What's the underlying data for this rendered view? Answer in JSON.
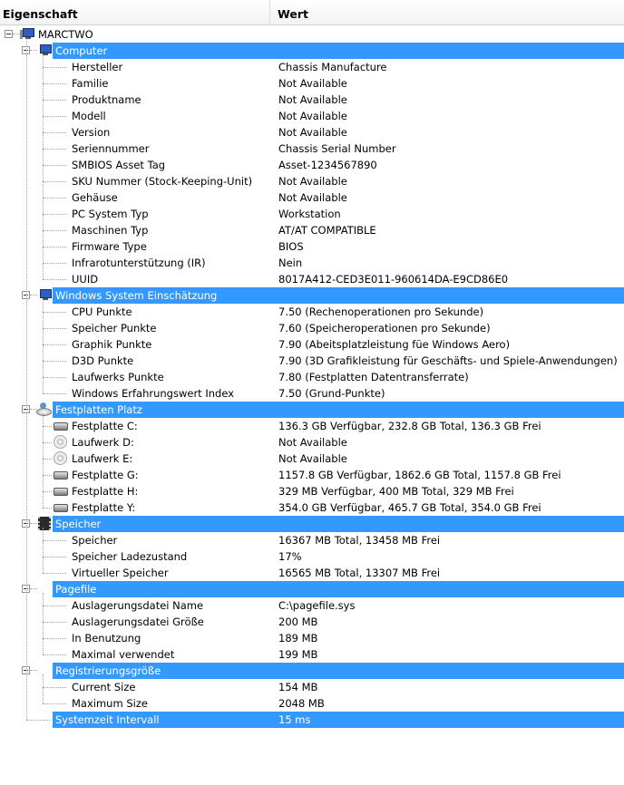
{
  "columns": {
    "property": "Eigenschaft",
    "value": "Wert"
  },
  "root": {
    "label": "MARCTWO",
    "icon": "computer-icon"
  },
  "groups": [
    {
      "id": "computer",
      "label": "Computer",
      "icon": "computer-icon",
      "items": [
        {
          "label": "Hersteller",
          "value": "Chassis Manufacture"
        },
        {
          "label": "Familie",
          "value": "Not Available"
        },
        {
          "label": "Produktname",
          "value": "Not Available"
        },
        {
          "label": "Modell",
          "value": "Not Available"
        },
        {
          "label": "Version",
          "value": "Not Available"
        },
        {
          "label": "Seriennummer",
          "value": "Chassis Serial Number"
        },
        {
          "label": "SMBIOS Asset Tag",
          "value": "Asset-1234567890"
        },
        {
          "label": "SKU Nummer (Stock-Keeping-Unit)",
          "value": "Not Available"
        },
        {
          "label": "Gehäuse",
          "value": "Not Available"
        },
        {
          "label": "PC System Typ",
          "value": "Workstation"
        },
        {
          "label": "Maschinen Typ",
          "value": "AT/AT COMPATIBLE"
        },
        {
          "label": "Firmware Type",
          "value": "BIOS"
        },
        {
          "label": "Infrarotunterstützung (IR)",
          "value": "Nein"
        },
        {
          "label": "UUID",
          "value": "8017A412-CED3E011-960614DA-E9CD86E0"
        }
      ]
    },
    {
      "id": "wsa",
      "label": "Windows System Einschätzung",
      "icon": "monitor-icon",
      "items": [
        {
          "label": "CPU Punkte",
          "value": "7.50 (Rechenoperationen pro Sekunde)"
        },
        {
          "label": "Speicher Punkte",
          "value": "7.60 (Speicheroperationen pro Sekunde)"
        },
        {
          "label": "Graphik Punkte",
          "value": "7.90 (Abeitsplatzleistung füe Windows Aero)"
        },
        {
          "label": "D3D Punkte",
          "value": "7.90 (3D Grafikleistung für Geschäfts- und Spiele-Anwendungen)"
        },
        {
          "label": "Laufwerks Punkte",
          "value": "7.80 (Festplatten Datentransferrate)"
        },
        {
          "label": "Windows Erfahrungswert Index",
          "value": "7.50 (Grund-Punkte)"
        }
      ]
    },
    {
      "id": "disk",
      "label": "Festplatten Platz",
      "icon": "disk-user-icon",
      "items": [
        {
          "label": "Festplatte C:",
          "value": "136.3 GB Verfügbar, 232.8 GB Total, 136.3 GB Frei",
          "icon": "hard-drive-icon"
        },
        {
          "label": "Laufwerk D:",
          "value": "Not Available",
          "icon": "cd-drive-icon"
        },
        {
          "label": "Laufwerk E:",
          "value": "Not Available",
          "icon": "cd-drive-icon"
        },
        {
          "label": "Festplatte G:",
          "value": "1157.8 GB Verfügbar, 1862.6 GB Total, 1157.8 GB Frei",
          "icon": "hard-drive-icon"
        },
        {
          "label": "Festplatte H:",
          "value": "329 MB Verfügbar, 400 MB Total, 329 MB Frei",
          "icon": "hard-drive-icon"
        },
        {
          "label": "Festplatte Y:",
          "value": "354.0 GB Verfügbar, 465.7 GB Total, 354.0 GB Frei",
          "icon": "hard-drive-icon"
        }
      ]
    },
    {
      "id": "memory",
      "label": "Speicher",
      "icon": "memory-icon",
      "items": [
        {
          "label": "Speicher",
          "value": "16367 MB Total, 13458 MB Frei"
        },
        {
          "label": "Speicher Ladezustand",
          "value": "17%"
        },
        {
          "label": "Virtueller Speicher",
          "value": "16565 MB Total, 13307 MB Frei"
        }
      ]
    },
    {
      "id": "pagefile",
      "label": "Pagefile",
      "items": [
        {
          "label": "Auslagerungsdatei Name",
          "value": "C:\\pagefile.sys"
        },
        {
          "label": "Auslagerungsdatei Größe",
          "value": "200 MB"
        },
        {
          "label": "In Benutzung",
          "value": "189 MB"
        },
        {
          "label": "Maximal verwendet",
          "value": "199 MB"
        }
      ]
    },
    {
      "id": "registry",
      "label": "Registrierungsgröße",
      "items": [
        {
          "label": "Current Size",
          "value": "154 MB"
        },
        {
          "label": "Maximum Size",
          "value": "2048 MB"
        }
      ]
    }
  ],
  "system_time": {
    "label": "Systemzeit Intervall",
    "value": "15 ms"
  },
  "colors": {
    "selection": "#3399ff",
    "selection_text": "#ffffff"
  }
}
